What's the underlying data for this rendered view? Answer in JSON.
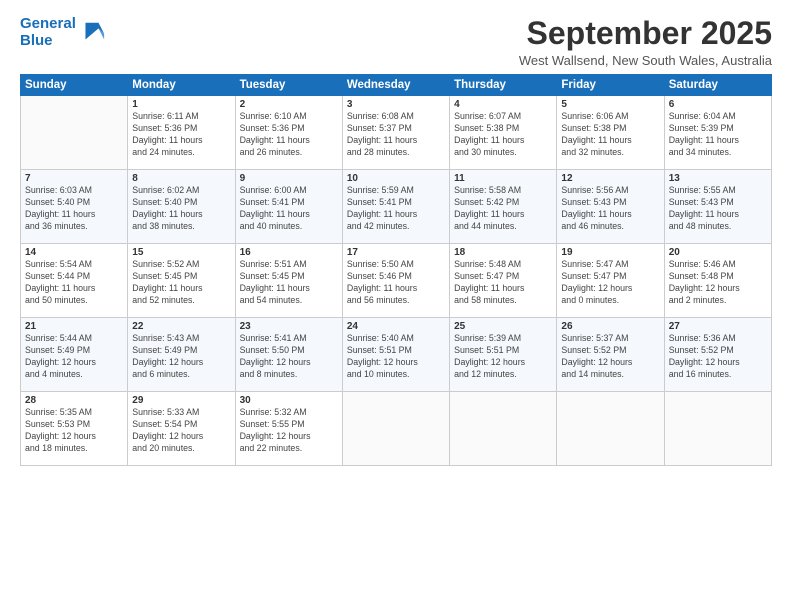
{
  "header": {
    "logo_line1": "General",
    "logo_line2": "Blue",
    "month": "September 2025",
    "location": "West Wallsend, New South Wales, Australia"
  },
  "days_of_week": [
    "Sunday",
    "Monday",
    "Tuesday",
    "Wednesday",
    "Thursday",
    "Friday",
    "Saturday"
  ],
  "weeks": [
    [
      {
        "num": "",
        "info": ""
      },
      {
        "num": "1",
        "info": "Sunrise: 6:11 AM\nSunset: 5:36 PM\nDaylight: 11 hours\nand 24 minutes."
      },
      {
        "num": "2",
        "info": "Sunrise: 6:10 AM\nSunset: 5:36 PM\nDaylight: 11 hours\nand 26 minutes."
      },
      {
        "num": "3",
        "info": "Sunrise: 6:08 AM\nSunset: 5:37 PM\nDaylight: 11 hours\nand 28 minutes."
      },
      {
        "num": "4",
        "info": "Sunrise: 6:07 AM\nSunset: 5:38 PM\nDaylight: 11 hours\nand 30 minutes."
      },
      {
        "num": "5",
        "info": "Sunrise: 6:06 AM\nSunset: 5:38 PM\nDaylight: 11 hours\nand 32 minutes."
      },
      {
        "num": "6",
        "info": "Sunrise: 6:04 AM\nSunset: 5:39 PM\nDaylight: 11 hours\nand 34 minutes."
      }
    ],
    [
      {
        "num": "7",
        "info": "Sunrise: 6:03 AM\nSunset: 5:40 PM\nDaylight: 11 hours\nand 36 minutes."
      },
      {
        "num": "8",
        "info": "Sunrise: 6:02 AM\nSunset: 5:40 PM\nDaylight: 11 hours\nand 38 minutes."
      },
      {
        "num": "9",
        "info": "Sunrise: 6:00 AM\nSunset: 5:41 PM\nDaylight: 11 hours\nand 40 minutes."
      },
      {
        "num": "10",
        "info": "Sunrise: 5:59 AM\nSunset: 5:41 PM\nDaylight: 11 hours\nand 42 minutes."
      },
      {
        "num": "11",
        "info": "Sunrise: 5:58 AM\nSunset: 5:42 PM\nDaylight: 11 hours\nand 44 minutes."
      },
      {
        "num": "12",
        "info": "Sunrise: 5:56 AM\nSunset: 5:43 PM\nDaylight: 11 hours\nand 46 minutes."
      },
      {
        "num": "13",
        "info": "Sunrise: 5:55 AM\nSunset: 5:43 PM\nDaylight: 11 hours\nand 48 minutes."
      }
    ],
    [
      {
        "num": "14",
        "info": "Sunrise: 5:54 AM\nSunset: 5:44 PM\nDaylight: 11 hours\nand 50 minutes."
      },
      {
        "num": "15",
        "info": "Sunrise: 5:52 AM\nSunset: 5:45 PM\nDaylight: 11 hours\nand 52 minutes."
      },
      {
        "num": "16",
        "info": "Sunrise: 5:51 AM\nSunset: 5:45 PM\nDaylight: 11 hours\nand 54 minutes."
      },
      {
        "num": "17",
        "info": "Sunrise: 5:50 AM\nSunset: 5:46 PM\nDaylight: 11 hours\nand 56 minutes."
      },
      {
        "num": "18",
        "info": "Sunrise: 5:48 AM\nSunset: 5:47 PM\nDaylight: 11 hours\nand 58 minutes."
      },
      {
        "num": "19",
        "info": "Sunrise: 5:47 AM\nSunset: 5:47 PM\nDaylight: 12 hours\nand 0 minutes."
      },
      {
        "num": "20",
        "info": "Sunrise: 5:46 AM\nSunset: 5:48 PM\nDaylight: 12 hours\nand 2 minutes."
      }
    ],
    [
      {
        "num": "21",
        "info": "Sunrise: 5:44 AM\nSunset: 5:49 PM\nDaylight: 12 hours\nand 4 minutes."
      },
      {
        "num": "22",
        "info": "Sunrise: 5:43 AM\nSunset: 5:49 PM\nDaylight: 12 hours\nand 6 minutes."
      },
      {
        "num": "23",
        "info": "Sunrise: 5:41 AM\nSunset: 5:50 PM\nDaylight: 12 hours\nand 8 minutes."
      },
      {
        "num": "24",
        "info": "Sunrise: 5:40 AM\nSunset: 5:51 PM\nDaylight: 12 hours\nand 10 minutes."
      },
      {
        "num": "25",
        "info": "Sunrise: 5:39 AM\nSunset: 5:51 PM\nDaylight: 12 hours\nand 12 minutes."
      },
      {
        "num": "26",
        "info": "Sunrise: 5:37 AM\nSunset: 5:52 PM\nDaylight: 12 hours\nand 14 minutes."
      },
      {
        "num": "27",
        "info": "Sunrise: 5:36 AM\nSunset: 5:52 PM\nDaylight: 12 hours\nand 16 minutes."
      }
    ],
    [
      {
        "num": "28",
        "info": "Sunrise: 5:35 AM\nSunset: 5:53 PM\nDaylight: 12 hours\nand 18 minutes."
      },
      {
        "num": "29",
        "info": "Sunrise: 5:33 AM\nSunset: 5:54 PM\nDaylight: 12 hours\nand 20 minutes."
      },
      {
        "num": "30",
        "info": "Sunrise: 5:32 AM\nSunset: 5:55 PM\nDaylight: 12 hours\nand 22 minutes."
      },
      {
        "num": "",
        "info": ""
      },
      {
        "num": "",
        "info": ""
      },
      {
        "num": "",
        "info": ""
      },
      {
        "num": "",
        "info": ""
      }
    ]
  ]
}
